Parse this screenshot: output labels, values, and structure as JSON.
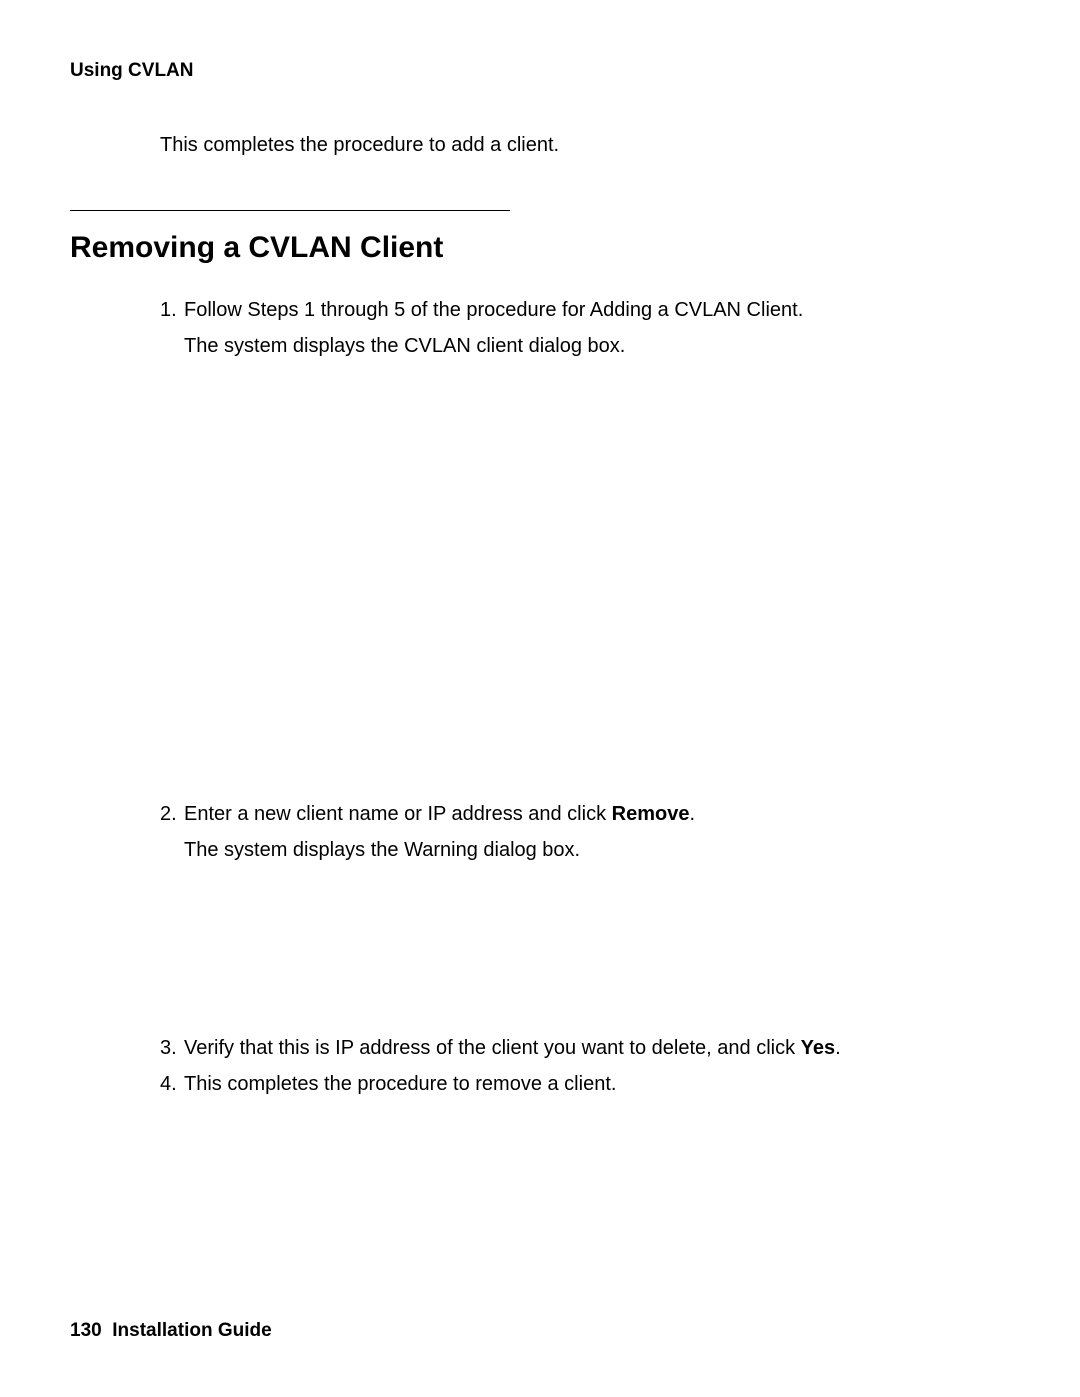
{
  "header": {
    "running_title": "Using CVLAN"
  },
  "intro_line": "This completes the procedure to add a client.",
  "section_heading": "Removing a CVLAN Client",
  "steps": {
    "s1_num": "1.",
    "s1_text": "Follow Steps 1 through 5 of the procedure for Adding a CVLAN Client.",
    "s1_sub": "The system displays the CVLAN client dialog box.",
    "s2_num": "2.",
    "s2_text_a": "Enter a new client name or IP address and click ",
    "s2_bold": "Remove",
    "s2_text_b": ".",
    "s2_sub": "The system displays the Warning dialog box.",
    "s3_num": "3.",
    "s3_text_a": "Verify that this is IP address of the client you want to delete, and click ",
    "s3_bold": "Yes",
    "s3_text_b": ".",
    "s4_num": "4.",
    "s4_text": "This completes the procedure to remove a client."
  },
  "footer": {
    "page_number": "130",
    "doc_title": "Installation Guide"
  }
}
